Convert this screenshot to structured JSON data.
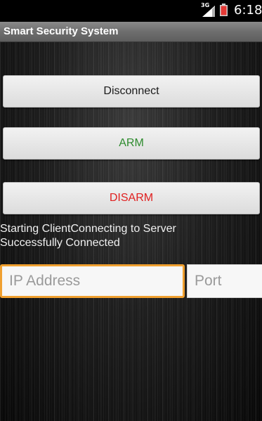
{
  "status_bar": {
    "network_type": "3G",
    "time": "6:18"
  },
  "app": {
    "title": "Smart Security System"
  },
  "buttons": {
    "disconnect": "Disconnect",
    "arm": "ARM",
    "disarm": "DISARM"
  },
  "status_messages": {
    "line1": "Starting ClientConnecting to Server",
    "line2": "Successfully Connected"
  },
  "inputs": {
    "ip_placeholder": "IP Address",
    "ip_value": "",
    "port_placeholder": "Port",
    "port_value": ""
  },
  "colors": {
    "arm_text": "#2e8b2e",
    "disarm_text": "#e02020",
    "focus_border": "#f0a030"
  },
  "icons": {
    "signal": "signal-strength-icon",
    "battery": "battery-icon"
  }
}
